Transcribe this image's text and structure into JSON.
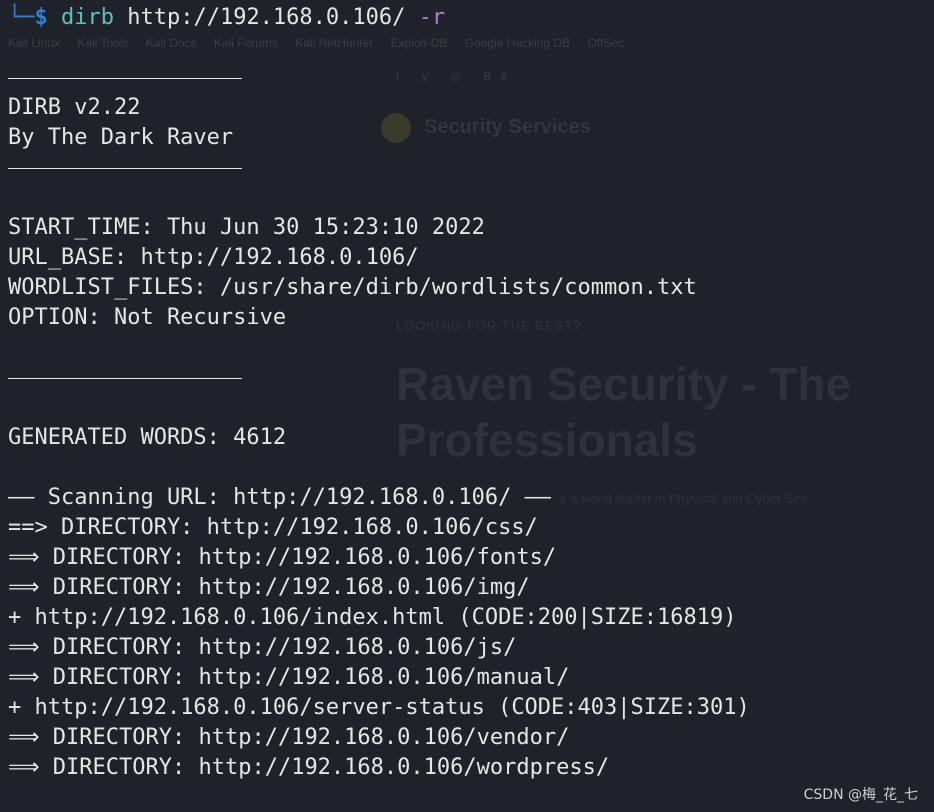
{
  "background_ghost": {
    "bookmarks": [
      "Kali Linux",
      "Kali Tools",
      "Kali Docs",
      "Kali Forums",
      "Kali NetHunter",
      "Exploit-DB",
      "Google Hacking DB",
      "OffSec"
    ],
    "social": "f y ◎ Bē",
    "logo_text": "Security Services",
    "tagline": "LOOKING FOR THE BEST?",
    "headline": "Raven Security - The Professionals",
    "subline": "s a world leader in Physical and Cyber Sec"
  },
  "prompt": {
    "corner": "└─",
    "symbol": "$",
    "command": "dirb",
    "argument": "http://192.168.0.106/",
    "flag": "-r"
  },
  "banner": {
    "version": "DIRB v2.22",
    "author": "By The Dark Raver"
  },
  "info": {
    "start_time": "START_TIME: Thu Jun 30 15:23:10 2022",
    "url_base": "URL_BASE: http://192.168.0.106/",
    "wordlist": "WORDLIST_FILES: /usr/share/dirb/wordlists/common.txt",
    "option": "OPTION: Not Recursive"
  },
  "generated": "GENERATED WORDS: 4612",
  "scanning": "—— Scanning URL: http://192.168.0.106/ ——",
  "results": [
    "==> DIRECTORY: http://192.168.0.106/css/",
    "⟹ DIRECTORY: http://192.168.0.106/fonts/",
    "⟹ DIRECTORY: http://192.168.0.106/img/",
    "+ http://192.168.0.106/index.html (CODE:200|SIZE:16819)",
    "⟹ DIRECTORY: http://192.168.0.106/js/",
    "⟹ DIRECTORY: http://192.168.0.106/manual/",
    "+ http://192.168.0.106/server-status (CODE:403|SIZE:301)",
    "⟹ DIRECTORY: http://192.168.0.106/vendor/",
    "⟹ DIRECTORY: http://192.168.0.106/wordpress/"
  ],
  "watermark": "CSDN @梅_花_七",
  "colors": {
    "background": "#1f2229",
    "text": "#e6e6e6",
    "prompt": "#2f7fd8",
    "command": "#5fc0c0",
    "flag": "#b07ad9"
  }
}
